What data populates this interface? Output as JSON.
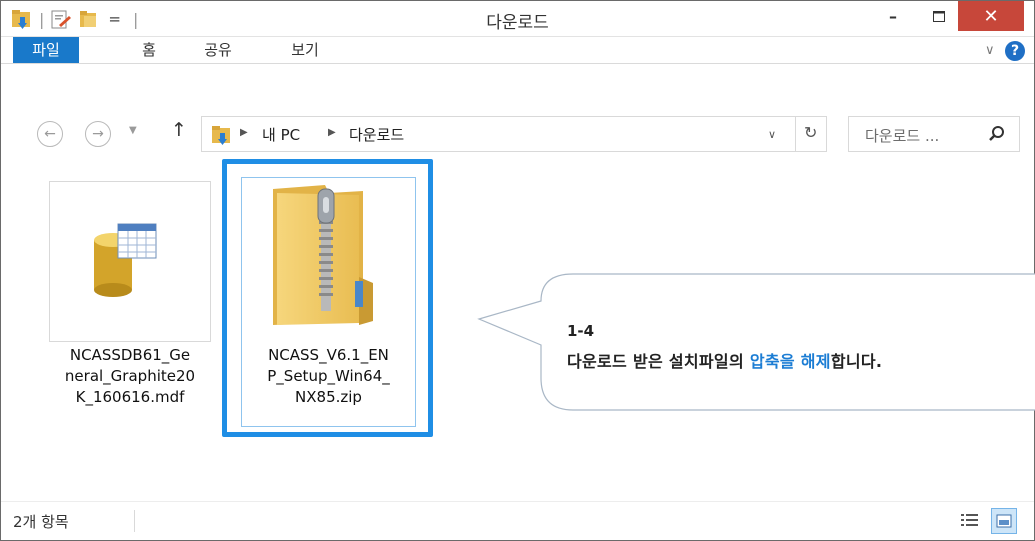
{
  "window": {
    "title": "다운로드",
    "quick_access_overflow": "=",
    "minimize_glyph": "–",
    "close_glyph": "✕"
  },
  "ribbon": {
    "tabs": [
      {
        "label": "파일",
        "active": true
      },
      {
        "label": "홈"
      },
      {
        "label": "공유"
      },
      {
        "label": "보기"
      }
    ],
    "expand_glyph": "∨",
    "help_glyph": "?"
  },
  "nav": {
    "back_glyph": "←",
    "forward_glyph": "→",
    "recent_glyph": "▼",
    "up_glyph": "↑",
    "refresh_glyph": "↻",
    "dropdown_glyph": "∨",
    "breadcrumb": [
      "내 PC",
      "다운로드"
    ],
    "search_placeholder": "다운로드 ..."
  },
  "files": [
    {
      "name": "NCASSDB61_General_Graphite20K_160616.mdf",
      "lines": [
        "NCASSDB61_Ge",
        "neral_Graphite20",
        "K_160616.mdf"
      ],
      "icon": "database-icon"
    },
    {
      "name": "NCASS_V6.1_ENP_Setup_Win64_NX85.zip",
      "lines": [
        "NCASS_V6.1_EN",
        "P_Setup_Win64_",
        "NX85.zip"
      ],
      "icon": "zip-folder-icon",
      "selected": true
    }
  ],
  "callout": {
    "step": "1-4",
    "text_before": "다운로드 받은 설치파일의 ",
    "highlight_1": "압축을",
    "text_middle": " ",
    "highlight_2": "해제",
    "text_after": "합니다."
  },
  "status": {
    "item_count": "2개 항목"
  },
  "colors": {
    "accent": "#1979ca",
    "highlight_border": "#1f8ee5",
    "close": "#c7473a",
    "callout_highlight": "#1c7dd4"
  }
}
